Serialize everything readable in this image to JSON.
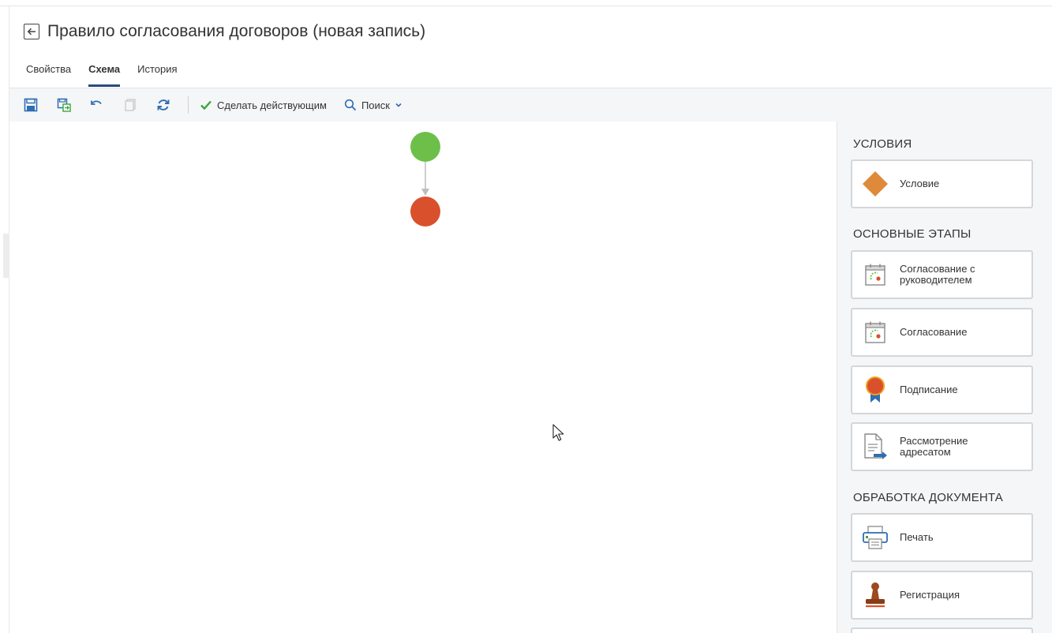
{
  "header": {
    "title": "Правило согласования договоров (новая запись)"
  },
  "tabs": [
    {
      "label": "Свойства",
      "active": false
    },
    {
      "label": "Схема",
      "active": true
    },
    {
      "label": "История",
      "active": false
    }
  ],
  "toolbar": {
    "make_active_label": "Сделать действующим",
    "search_label": "Поиск",
    "accent_color": "#2e6db4",
    "check_color": "#3aa63a"
  },
  "diagram": {
    "start_color": "#6cc04a",
    "end_color": "#d9512c",
    "arrow_color": "#bdbdbd"
  },
  "palette": {
    "sections": [
      {
        "title": "УСЛОВИЯ",
        "items": [
          {
            "label": "Условие",
            "icon": "diamond-icon"
          }
        ]
      },
      {
        "title": "ОСНОВНЫЕ ЭТАПЫ",
        "items": [
          {
            "label_line1": "Согласование с",
            "label_line2": "руководителем",
            "icon": "calendar-icon"
          },
          {
            "label": "Согласование",
            "icon": "calendar-icon"
          },
          {
            "label": "Подписание",
            "icon": "ribbon-icon"
          },
          {
            "label_line1": "Рассмотрение",
            "label_line2": "адресатом",
            "icon": "document-arrow-icon"
          }
        ]
      },
      {
        "title": "ОБРАБОТКА ДОКУМЕНТА",
        "items": [
          {
            "label": "Печать",
            "icon": "printer-icon"
          },
          {
            "label": "Регистрация",
            "icon": "stamp-icon"
          }
        ]
      }
    ]
  }
}
